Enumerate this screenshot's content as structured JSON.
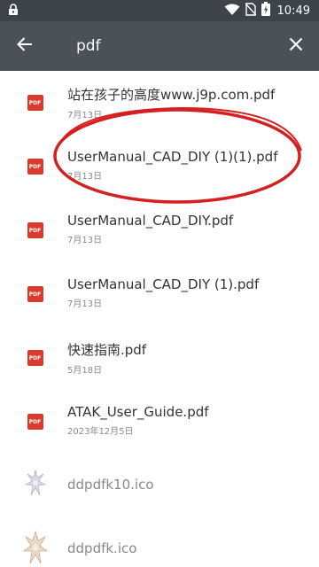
{
  "status_bar": {
    "time": "10:49",
    "icons": [
      "lock-icon",
      "wifi-icon",
      "no-sim-icon",
      "battery-charging-icon"
    ]
  },
  "search": {
    "value": "pdf",
    "back_icon": "arrow-back-icon",
    "clear_icon": "close-icon"
  },
  "results": [
    {
      "name": "站在孩子的高度www.j9p.com.pdf",
      "date": "7月13日",
      "type": "pdf",
      "badge": "PDF"
    },
    {
      "name": "UserManual_CAD_DIY (1)(1).pdf",
      "date": "7月13日",
      "type": "pdf",
      "badge": "PDF"
    },
    {
      "name": "UserManual_CAD_DIY.pdf",
      "date": "7月13日",
      "type": "pdf",
      "badge": "PDF"
    },
    {
      "name": "UserManual_CAD_DIY (1).pdf",
      "date": "7月13日",
      "type": "pdf",
      "badge": "PDF"
    },
    {
      "name": "快速指南.pdf",
      "date": "5月18日",
      "type": "pdf",
      "badge": "PDF"
    },
    {
      "name": "ATAK_User_Guide.pdf",
      "date": "2023年12月5日",
      "type": "pdf",
      "badge": "PDF"
    },
    {
      "name": "ddpdfk10.ico",
      "date": "",
      "type": "ico",
      "badge": ""
    },
    {
      "name": "ddpdfk.ico",
      "date": "",
      "type": "ico",
      "badge": ""
    }
  ],
  "colors": {
    "status_bar": "#3d4449",
    "app_bar": "#4a5157",
    "pdf_badge": "#d93a2d",
    "annotation_ellipse": "#d42020"
  }
}
